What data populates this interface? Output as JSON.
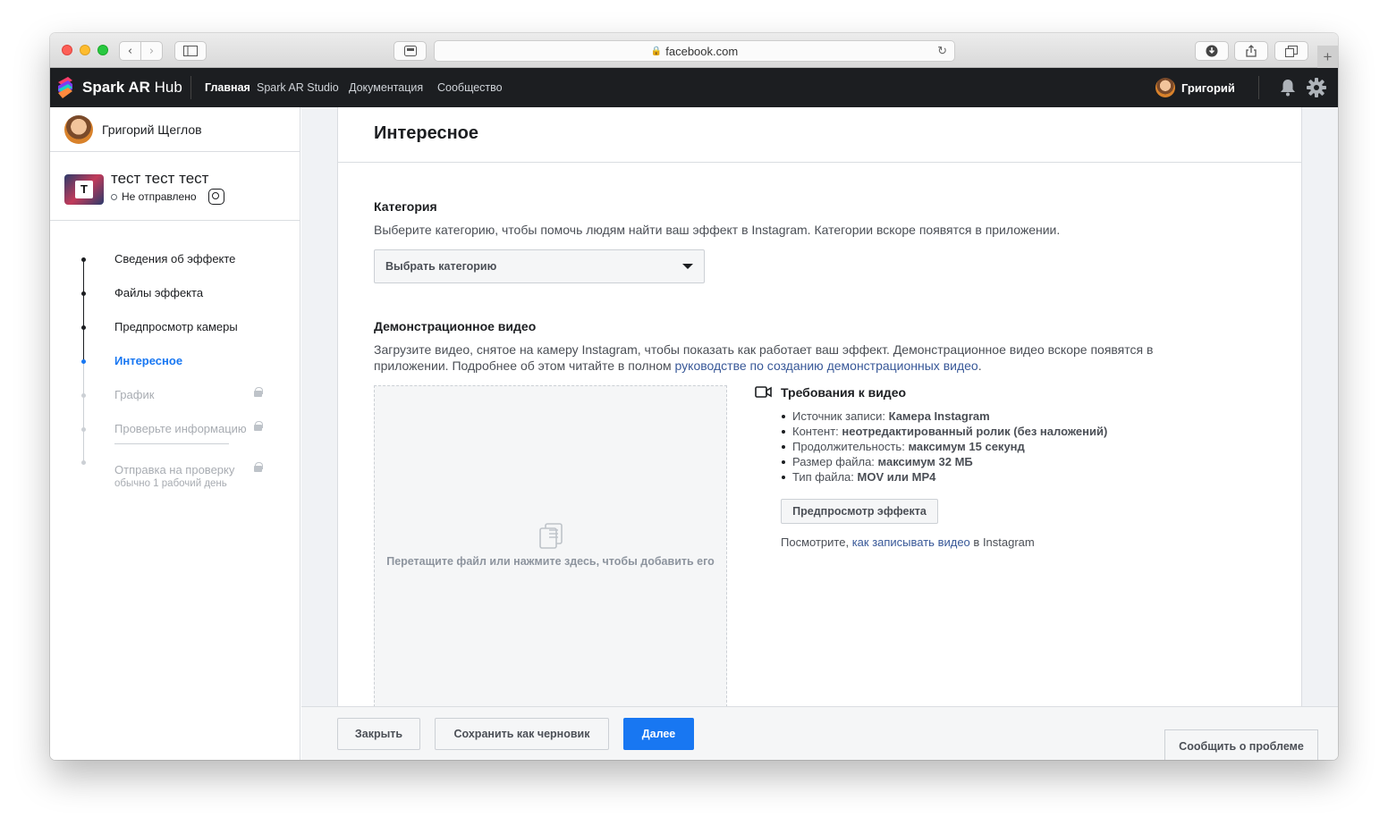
{
  "browser": {
    "url": "facebook.com"
  },
  "topnav": {
    "brand": "Spark AR Hub",
    "brand_bold": "Spark AR",
    "brand_light": "Hub",
    "links": [
      "Главная",
      "Spark AR Studio",
      "Документация",
      "Сообщество"
    ],
    "active_link": "Главная",
    "user_name": "Григорий"
  },
  "sidebar": {
    "user_full_name": "Григорий Щеглов",
    "effect": {
      "name": "тест тест тест",
      "status": "Не отправлено",
      "thumb_letter": "T"
    },
    "steps": [
      {
        "label": "Сведения об эффекте",
        "state": "done"
      },
      {
        "label": "Файлы эффекта",
        "state": "done"
      },
      {
        "label": "Предпросмотр камеры",
        "state": "done"
      },
      {
        "label": "Интересное",
        "state": "active"
      },
      {
        "label": "График",
        "state": "locked"
      },
      {
        "label": "Проверьте информацию",
        "state": "locked"
      },
      {
        "label": "Отправка на проверку",
        "sublabel": "обычно 1 рабочий день",
        "state": "locked"
      }
    ]
  },
  "main": {
    "title": "Интересное",
    "category": {
      "title": "Категория",
      "description": "Выберите категорию, чтобы помочь людям найти ваш эффект в Instagram. Категории вскоре появятся в приложении.",
      "select_value": "Выбрать категорию"
    },
    "demo_video": {
      "title": "Демонстрационное видео",
      "description_1": "Загрузите видео, снятое на камеру Instagram, чтобы показать как работает ваш эффект. Демонстрационное видео вскоре появятся в",
      "description_2": "приложении. Подробнее об этом читайте в полном",
      "description_link": "руководстве по созданию демонстрационных видео",
      "description_end": ".",
      "dropzone_text": "Перетащите файл или нажмите здесь, чтобы добавить его",
      "requirements_title": "Требования к видео",
      "requirements": [
        {
          "label": "Источник записи:",
          "value": "Камера Instagram"
        },
        {
          "label": "Контент:",
          "value": "неотредактированный ролик (без наложений)"
        },
        {
          "label": "Продолжительность:",
          "value": "максимум 15 секунд"
        },
        {
          "label": "Размер файла:",
          "value": "максимум 32 МБ"
        },
        {
          "label": "Тип файла:",
          "value": "MOV или MP4"
        }
      ],
      "preview_button": "Предпросмотр эффекта",
      "see_how_prefix": "Посмотрите,",
      "see_how_link": "как записывать видео",
      "see_how_suffix": "в Instagram"
    }
  },
  "footer": {
    "close": "Закрыть",
    "save_draft": "Сохранить как черновик",
    "next": "Далее",
    "report": "Сообщить о проблеме"
  },
  "colors": {
    "accent": "#1877f2",
    "nav_bg": "#1c1e21",
    "link": "#385898"
  }
}
